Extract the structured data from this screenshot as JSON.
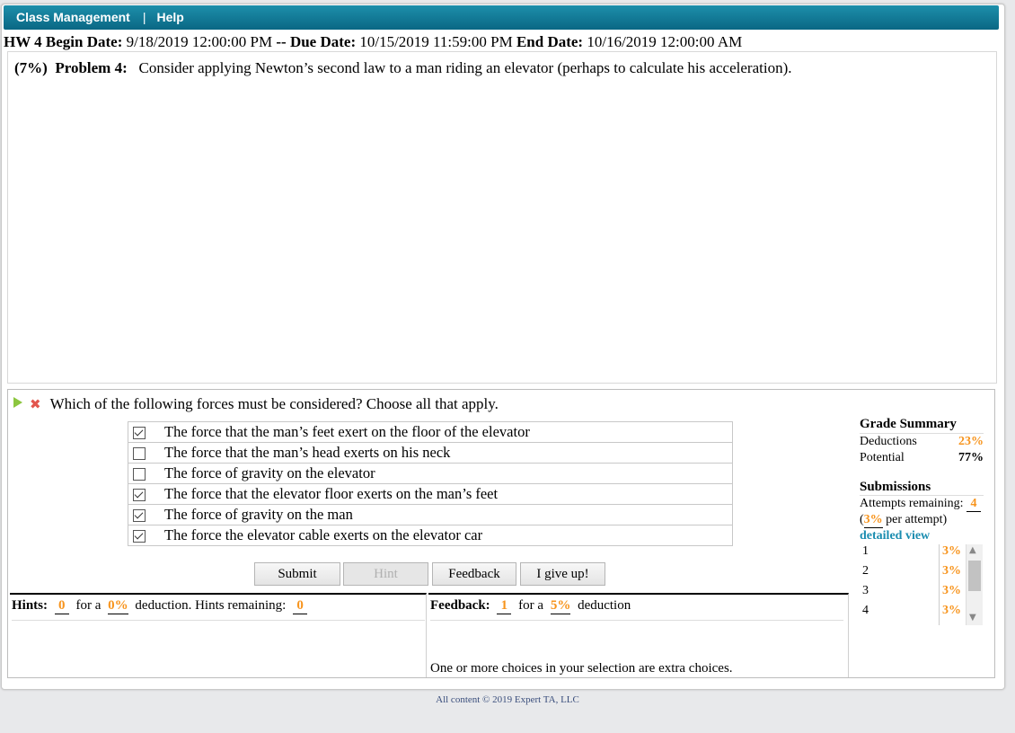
{
  "topbar": {
    "menu1": "Class Management",
    "sep": "|",
    "menu2": "Help"
  },
  "dates": {
    "hw": "HW 4",
    "begin_label": "Begin Date:",
    "begin": "9/18/2019 12:00:00 PM",
    "dash": "--",
    "due_label": "Due Date:",
    "due": "10/15/2019 11:59:00 PM",
    "end_label": "End Date:",
    "end": "10/16/2019 12:00:00 AM"
  },
  "problem": {
    "weight": "(7%)",
    "number": "Problem 4:",
    "text": "Consider applying Newton’s second law to a man riding an elevator (perhaps to calculate his acceleration)."
  },
  "question": {
    "prompt": "Which of the following forces must be considered? Choose all that apply.",
    "choices": [
      {
        "label": "The force that the man’s feet exert on the floor of the elevator",
        "checked": true
      },
      {
        "label": "The force that the man’s head exerts on his neck",
        "checked": false
      },
      {
        "label": "The force of gravity on the elevator",
        "checked": false
      },
      {
        "label": "The force that the elevator floor exerts on the man’s feet",
        "checked": true
      },
      {
        "label": "The force of gravity on the man",
        "checked": true
      },
      {
        "label": "The force the elevator cable exerts on the elevator car",
        "checked": true
      }
    ]
  },
  "buttons": {
    "submit": "Submit",
    "hint": "Hint",
    "feedback": "Feedback",
    "give_up": "I give up!"
  },
  "hints": {
    "label": "Hints:",
    "count": "0",
    "for_a": "for a",
    "pct": "0%",
    "deduction": "deduction. Hints remaining:",
    "remaining": "0"
  },
  "feedback": {
    "label": "Feedback:",
    "count": "1",
    "for_a": "for a",
    "pct": "5%",
    "deduction": "deduction",
    "message": "One or more choices in your selection are extra choices."
  },
  "grade_summary": {
    "title": "Grade Summary",
    "deductions_label": "Deductions",
    "deductions": "23%",
    "potential_label": "Potential",
    "potential": "77%"
  },
  "submissions": {
    "title": "Submissions",
    "attempts_label": "Attempts remaining:",
    "attempts": "4",
    "per_open": "(",
    "per_pct": "3%",
    "per_text": "per attempt)",
    "detailed": "detailed view",
    "rows": [
      {
        "n": "1",
        "v": "3%"
      },
      {
        "n": "2",
        "v": "3%"
      },
      {
        "n": "3",
        "v": "3%"
      },
      {
        "n": "4",
        "v": "3%"
      }
    ]
  },
  "footer": "All content © 2019 Expert TA, LLC",
  "colors": {
    "topbar": "#0a6784",
    "accent_orange": "#f7941d",
    "link_blue": "#1b8db0"
  },
  "icons": {
    "status_play": "play-icon",
    "status_wrong": "x-icon"
  }
}
